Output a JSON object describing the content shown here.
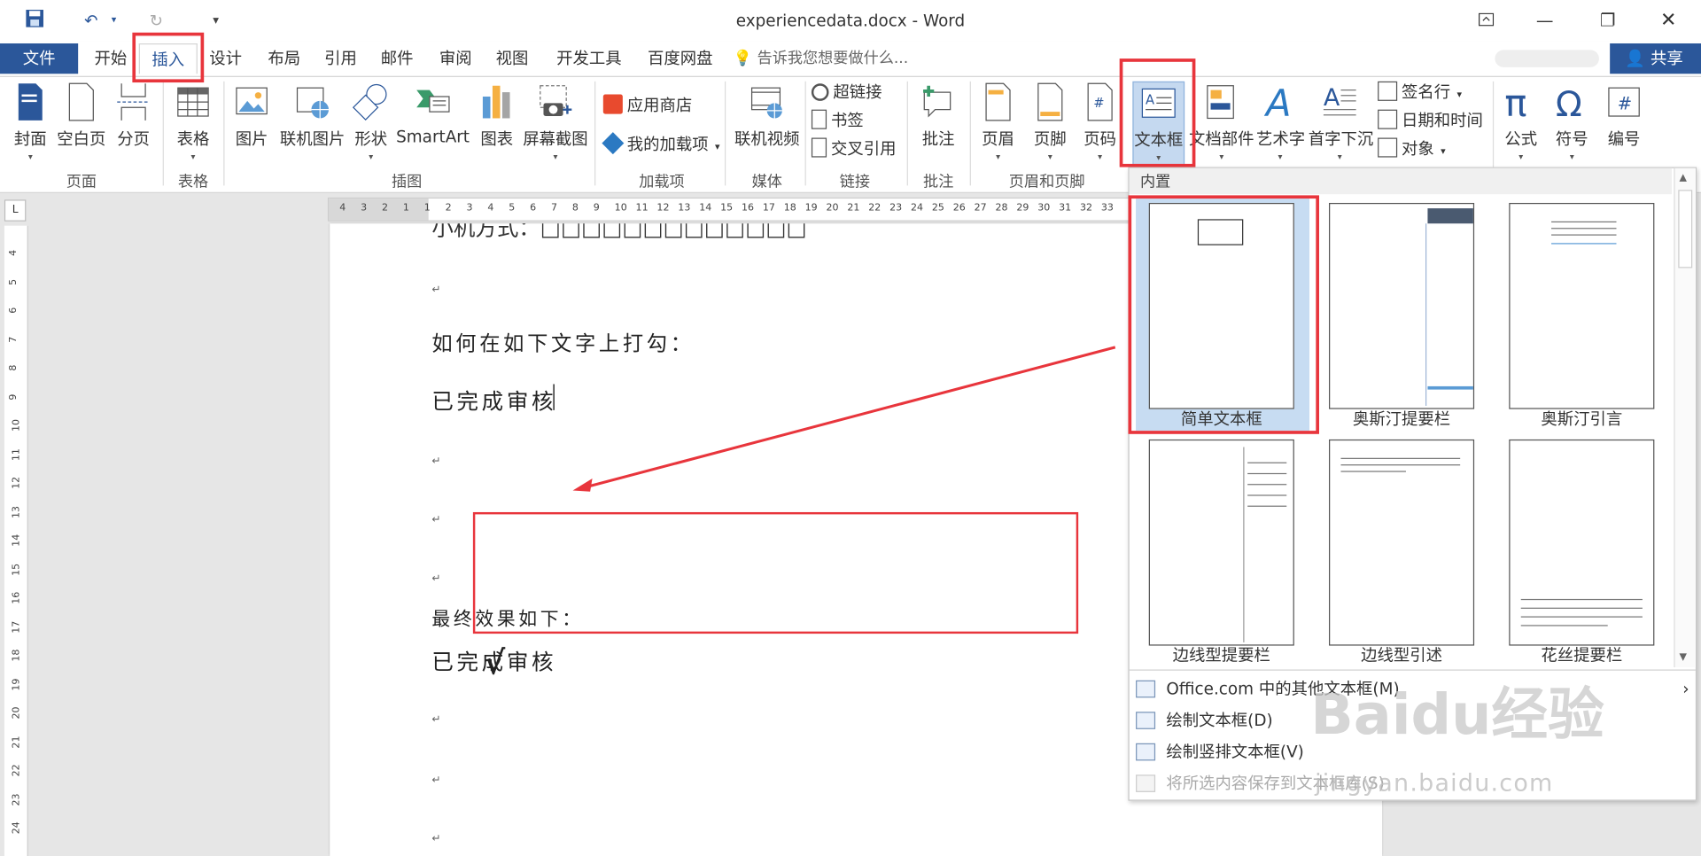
{
  "window": {
    "title": "experiencedata.docx - Word"
  },
  "qat": {
    "save": "save-icon",
    "undo": "↶",
    "redo": "↻",
    "customize": "▾"
  },
  "tabs": {
    "file": "文件",
    "items": [
      "开始",
      "插入",
      "设计",
      "布局",
      "引用",
      "邮件",
      "审阅",
      "视图",
      "开发工具",
      "百度网盘"
    ],
    "active": "插入",
    "tell_me": "告诉我您想要做什么...",
    "share": "共享"
  },
  "ribbon": {
    "groups": [
      "页面",
      "表格",
      "插图",
      "加载项",
      "媒体",
      "链接",
      "批注",
      "页眉和页脚"
    ],
    "pages": [
      "封面",
      "空白页",
      "分页"
    ],
    "table": "表格",
    "illustrations": [
      "图片",
      "联机图片",
      "形状",
      "SmartArt",
      "图表",
      "屏幕截图"
    ],
    "addins": [
      "应用商店",
      "我的加载项"
    ],
    "media": "联机视频",
    "links": [
      "超链接",
      "书签",
      "交叉引用"
    ],
    "comment": "批注",
    "header_footer": [
      "页眉",
      "页脚",
      "页码"
    ],
    "text": [
      "文本框",
      "文档部件",
      "艺术字",
      "首字下沉"
    ],
    "text_small": [
      "签名行",
      "日期和时间",
      "对象"
    ],
    "symbols": [
      "公式",
      "符号",
      "编号"
    ],
    "colors": {
      "accent": "#2b579a",
      "annotation": "#e8353c"
    }
  },
  "ruler": {
    "h_ticks": [
      "4",
      "3",
      "2",
      "1",
      "1",
      "2",
      "3",
      "4",
      "5",
      "6",
      "7",
      "8",
      "9",
      "10",
      "11",
      "12",
      "13",
      "14",
      "15",
      "16",
      "17",
      "18",
      "19",
      "20",
      "21",
      "22",
      "23",
      "24",
      "25",
      "26",
      "27",
      "28",
      "29",
      "30",
      "31",
      "32",
      "33"
    ],
    "v_ticks": [
      "4",
      "5",
      "6",
      "7",
      "8",
      "9",
      "10",
      "11",
      "12",
      "13",
      "14",
      "15",
      "16",
      "17",
      "18",
      "19",
      "20",
      "21",
      "22",
      "23",
      "24"
    ]
  },
  "document": {
    "line_top": "小机方式：□□□□□□□□□□□□□",
    "question": "如何在如下文字上打勾：",
    "text1": "已完成审核",
    "final_label": "最终效果如下：",
    "text2": "已完成审核",
    "check": "√",
    "para_mark": "↵"
  },
  "gallery": {
    "header": "内置",
    "items": [
      "简单文本框",
      "奥斯汀提要栏",
      "奥斯汀引言",
      "边线型提要栏",
      "边线型引述",
      "花丝提要栏"
    ],
    "selected": "简单文本框"
  },
  "menu": [
    {
      "label": "Office.com 中的其他文本框(M)",
      "enabled": true,
      "arrow": "›"
    },
    {
      "label": "绘制文本框(D)",
      "enabled": true
    },
    {
      "label": "绘制竖排文本框(V)",
      "enabled": true
    },
    {
      "label": "将所选内容保存到文本框库(S)",
      "enabled": false
    }
  ],
  "watermark": {
    "brand": "Baidu经验",
    "url": "jingyan.baidu.com"
  }
}
